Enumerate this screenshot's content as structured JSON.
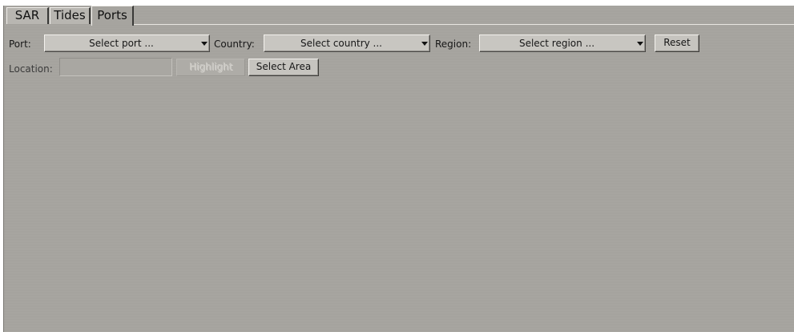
{
  "tabs": [
    {
      "label": "SAR",
      "active": false
    },
    {
      "label": "Tides",
      "active": false
    },
    {
      "label": "Ports",
      "active": true
    }
  ],
  "filters": {
    "port_label": "Port:",
    "port_value": "Select port ...",
    "country_label": "Country:",
    "country_value": "Select country ...",
    "region_label": "Region:",
    "region_value": "Select region ...",
    "reset_label": "Reset"
  },
  "location": {
    "label": "Location:",
    "value": "",
    "highlight_label": "Highlight",
    "highlight_enabled": false,
    "select_area_label": "Select Area"
  },
  "colors": {
    "panel_background": "#a6a49f",
    "button_face": "#c6c4bf"
  }
}
